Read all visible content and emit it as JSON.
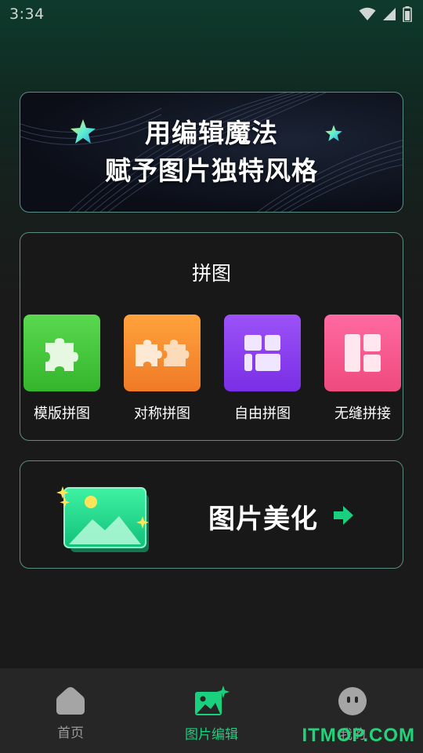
{
  "status_bar": {
    "time": "3:34"
  },
  "banner": {
    "line1": "用编辑魔法",
    "line2": "赋予图片独特风格"
  },
  "collage": {
    "title": "拼图",
    "tools": [
      {
        "label": "模版拼图",
        "color": "#44c43a",
        "icon": "puzzle-piece-icon"
      },
      {
        "label": "对称拼图",
        "color": "#f38a2c",
        "icon": "double-puzzle-icon"
      },
      {
        "label": "自由拼图",
        "color": "#8a3cf0",
        "icon": "free-layout-icon"
      },
      {
        "label": "无缝拼接",
        "color": "#f04e86",
        "icon": "seamless-grid-icon"
      }
    ]
  },
  "beautify": {
    "label": "图片美化",
    "icon": "photo-sparkle-icon"
  },
  "nav": {
    "items": [
      {
        "label": "首页",
        "icon": "home-icon",
        "active": false
      },
      {
        "label": "图片编辑",
        "icon": "image-edit-icon",
        "active": true
      },
      {
        "label": "我的",
        "icon": "face-icon",
        "active": false
      }
    ]
  },
  "watermark": "ITMOP.COM",
  "colors": {
    "accent": "#19d07f",
    "inactive": "#9a9a9a",
    "card_border": "#5d8c82"
  }
}
